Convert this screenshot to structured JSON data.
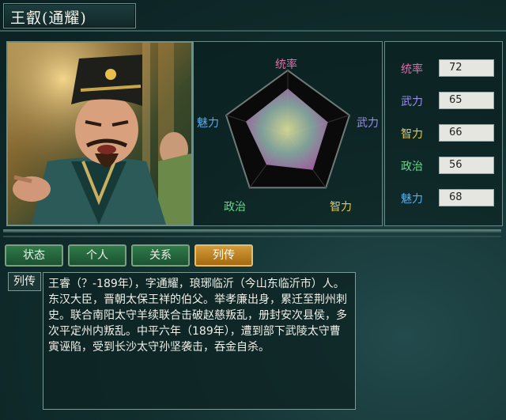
{
  "title": "王叡(通耀)",
  "radar": {
    "labels": {
      "top": "统率",
      "right": "武力",
      "bottom_right": "智力",
      "bottom_left": "政治",
      "left": "魅力"
    },
    "values": [
      72,
      65,
      66,
      56,
      68
    ]
  },
  "stats": [
    {
      "label": "统率",
      "value": "72",
      "color": "#d870a8"
    },
    {
      "label": "武力",
      "value": "65",
      "color": "#9a8cf0"
    },
    {
      "label": "智力",
      "value": "66",
      "color": "#e6c84a"
    },
    {
      "label": "政治",
      "value": "56",
      "color": "#6ad68a"
    },
    {
      "label": "魅力",
      "value": "68",
      "color": "#5aaee8"
    }
  ],
  "tabs": [
    "状态",
    "个人",
    "关系",
    "列传"
  ],
  "active_tab": "列传",
  "bio": {
    "label": "列传",
    "text": "王睿（？-189年），字通耀，琅琊临沂（今山东临沂市）人。东汉大臣，晋朝太保王祥的伯父。举孝廉出身，累迁至荆州刺史。联合南阳太守羊续联合击破赵慈叛乱，册封安次县侯，多次平定州内叛乱。中平六年（189年），遭到部下武陵太守曹寅诬陷，受到长沙太守孙坚袭击，吞金自杀。"
  }
}
